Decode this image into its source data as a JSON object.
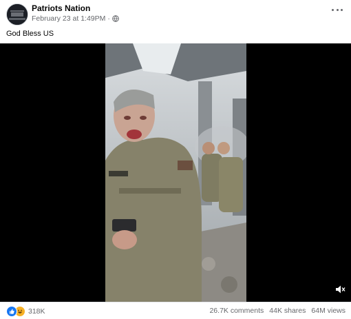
{
  "post": {
    "page_name": "Patriots Nation",
    "timestamp": "February 23 at 1:49PM",
    "separator": "·",
    "audience_icon": "globe-icon",
    "caption": "God Bless US"
  },
  "video": {
    "mute_icon": "speaker-muted-icon"
  },
  "footer": {
    "reaction_icons": [
      "like-icon",
      "haha-icon"
    ],
    "reaction_count": "318K",
    "comments": "26.7K comments",
    "shares": "44K shares",
    "views": "64M views"
  },
  "colors": {
    "link_blue": "#1877f2",
    "meta_gray": "#65676b",
    "haha_yellow": "#f7b125"
  }
}
